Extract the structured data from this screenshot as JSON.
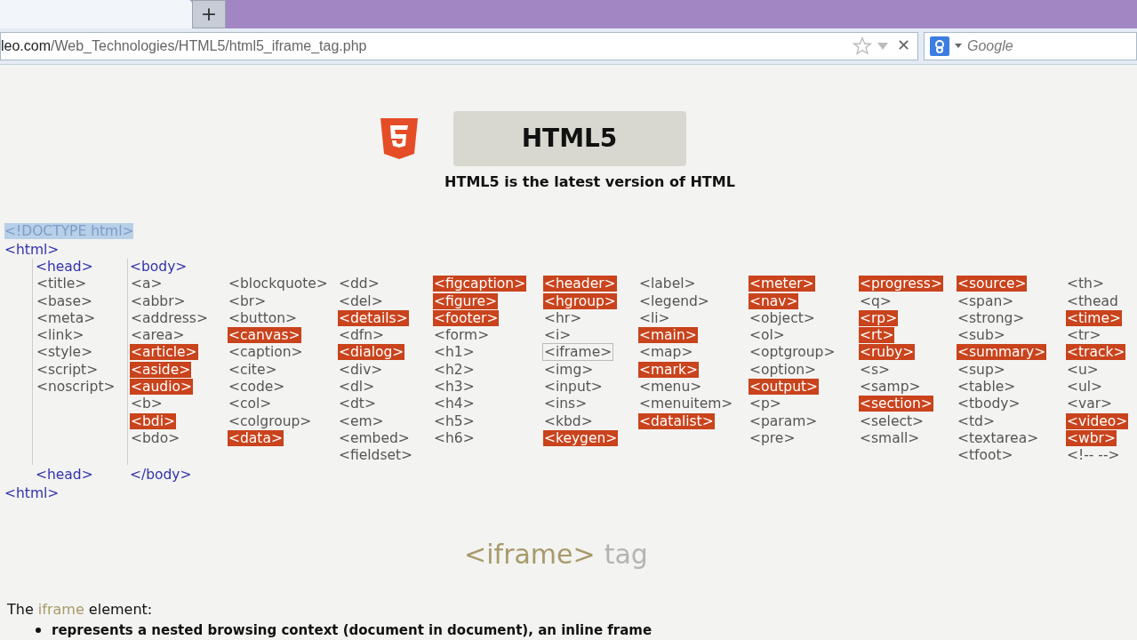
{
  "browser": {
    "new_tab": "+",
    "address": {
      "domain": "leo.com",
      "path": "/Web_Technologies/HTML5/html5_iframe_tag.php"
    },
    "stop": "✕",
    "search": {
      "placeholder": "Google"
    }
  },
  "banner": {
    "title": "HTML5",
    "subtitle": "HTML5 is the latest version of HTML"
  },
  "tree": {
    "doctype": {
      "text": "<!DOCTYPE html>",
      "selected": true
    },
    "html_open": "<html>",
    "head_open": "<head>",
    "body_open": "<body>",
    "head_close": "<head>",
    "body_close": "</body>",
    "html_close": "<html>",
    "head_items": [
      {
        "text": "<title>",
        "kind": "plain"
      },
      {
        "text": "<base>",
        "kind": "plain"
      },
      {
        "text": "<meta>",
        "kind": "plain"
      },
      {
        "text": "<link>",
        "kind": "plain"
      },
      {
        "text": "<style>",
        "kind": "plain"
      },
      {
        "text": "<script>",
        "kind": "plain"
      },
      {
        "text": "<noscript>",
        "kind": "plain"
      }
    ],
    "body_columns": [
      [
        {
          "text": "<a>",
          "kind": "plain"
        },
        {
          "text": "<abbr>",
          "kind": "plain"
        },
        {
          "text": "<address>",
          "kind": "plain"
        },
        {
          "text": "<area>",
          "kind": "plain"
        },
        {
          "text": "<article>",
          "kind": "new"
        },
        {
          "text": "<aside>",
          "kind": "new"
        },
        {
          "text": "<audio>",
          "kind": "new"
        },
        {
          "text": "<b>",
          "kind": "plain"
        },
        {
          "text": "<bdi>",
          "kind": "new"
        },
        {
          "text": "<bdo>",
          "kind": "plain"
        }
      ],
      [
        {
          "text": "<blockquote>",
          "kind": "plain"
        },
        {
          "text": "<br>",
          "kind": "plain"
        },
        {
          "text": "<button>",
          "kind": "plain"
        },
        {
          "text": "<canvas>",
          "kind": "new"
        },
        {
          "text": "<caption>",
          "kind": "plain"
        },
        {
          "text": "<cite>",
          "kind": "plain"
        },
        {
          "text": "<code>",
          "kind": "plain"
        },
        {
          "text": "<col>",
          "kind": "plain"
        },
        {
          "text": "<colgroup>",
          "kind": "plain"
        },
        {
          "text": "<data>",
          "kind": "new"
        }
      ],
      [
        {
          "text": "<dd>",
          "kind": "plain"
        },
        {
          "text": "<del>",
          "kind": "plain"
        },
        {
          "text": "<details>",
          "kind": "new"
        },
        {
          "text": "<dfn>",
          "kind": "plain"
        },
        {
          "text": "<dialog>",
          "kind": "new"
        },
        {
          "text": "<div>",
          "kind": "plain"
        },
        {
          "text": "<dl>",
          "kind": "plain"
        },
        {
          "text": "<dt>",
          "kind": "plain"
        },
        {
          "text": "<em>",
          "kind": "plain"
        },
        {
          "text": "<embed>",
          "kind": "plain"
        },
        {
          "text": "<fieldset>",
          "kind": "plain"
        }
      ],
      [
        {
          "text": "<figcaption>",
          "kind": "new"
        },
        {
          "text": "<figure>",
          "kind": "new"
        },
        {
          "text": "<footer>",
          "kind": "new"
        },
        {
          "text": "<form>",
          "kind": "plain"
        },
        {
          "text": "<h1>",
          "kind": "plain"
        },
        {
          "text": "<h2>",
          "kind": "plain"
        },
        {
          "text": "<h3>",
          "kind": "plain"
        },
        {
          "text": "<h4>",
          "kind": "plain"
        },
        {
          "text": "<h5>",
          "kind": "plain"
        },
        {
          "text": "<h6>",
          "kind": "plain"
        }
      ],
      [
        {
          "text": "<header>",
          "kind": "new"
        },
        {
          "text": "<hgroup>",
          "kind": "new"
        },
        {
          "text": "<hr>",
          "kind": "plain"
        },
        {
          "text": "<i>",
          "kind": "plain"
        },
        {
          "text": "<iframe>",
          "kind": "current"
        },
        {
          "text": "<img>",
          "kind": "plain"
        },
        {
          "text": "<input>",
          "kind": "plain"
        },
        {
          "text": "<ins>",
          "kind": "plain"
        },
        {
          "text": "<kbd>",
          "kind": "plain"
        },
        {
          "text": "<keygen>",
          "kind": "new"
        }
      ],
      [
        {
          "text": "<label>",
          "kind": "plain"
        },
        {
          "text": "<legend>",
          "kind": "plain"
        },
        {
          "text": "<li>",
          "kind": "plain"
        },
        {
          "text": "<main>",
          "kind": "new"
        },
        {
          "text": "<map>",
          "kind": "plain"
        },
        {
          "text": "<mark>",
          "kind": "new"
        },
        {
          "text": "<menu>",
          "kind": "plain"
        },
        {
          "text": "<menuitem>",
          "kind": "plain"
        },
        {
          "text": "<datalist>",
          "kind": "new"
        }
      ],
      [
        {
          "text": "<meter>",
          "kind": "new"
        },
        {
          "text": "<nav>",
          "kind": "new"
        },
        {
          "text": "<object>",
          "kind": "plain"
        },
        {
          "text": "<ol>",
          "kind": "plain"
        },
        {
          "text": "<optgroup>",
          "kind": "plain"
        },
        {
          "text": "<option>",
          "kind": "plain"
        },
        {
          "text": "<output>",
          "kind": "new"
        },
        {
          "text": "<p>",
          "kind": "plain"
        },
        {
          "text": "<param>",
          "kind": "plain"
        },
        {
          "text": "<pre>",
          "kind": "plain"
        }
      ],
      [
        {
          "text": "<progress>",
          "kind": "new"
        },
        {
          "text": "<q>",
          "kind": "plain"
        },
        {
          "text": "<rp>",
          "kind": "new"
        },
        {
          "text": "<rt>",
          "kind": "new"
        },
        {
          "text": "<ruby>",
          "kind": "new"
        },
        {
          "text": "<s>",
          "kind": "plain"
        },
        {
          "text": "<samp>",
          "kind": "plain"
        },
        {
          "text": "<section>",
          "kind": "new"
        },
        {
          "text": "<select>",
          "kind": "plain"
        },
        {
          "text": "<small>",
          "kind": "plain"
        }
      ],
      [
        {
          "text": "<source>",
          "kind": "new"
        },
        {
          "text": "<span>",
          "kind": "plain"
        },
        {
          "text": "<strong>",
          "kind": "plain"
        },
        {
          "text": "<sub>",
          "kind": "plain"
        },
        {
          "text": "<summary>",
          "kind": "new"
        },
        {
          "text": "<sup>",
          "kind": "plain"
        },
        {
          "text": "<table>",
          "kind": "plain"
        },
        {
          "text": "<tbody>",
          "kind": "plain"
        },
        {
          "text": "<td>",
          "kind": "plain"
        },
        {
          "text": "<textarea>",
          "kind": "plain"
        },
        {
          "text": "<tfoot>",
          "kind": "plain"
        }
      ],
      [
        {
          "text": "<th>",
          "kind": "plain"
        },
        {
          "text": "<thead",
          "kind": "plain"
        },
        {
          "text": "<time>",
          "kind": "new"
        },
        {
          "text": "<tr>",
          "kind": "plain"
        },
        {
          "text": "<track>",
          "kind": "new"
        },
        {
          "text": "<u>",
          "kind": "plain"
        },
        {
          "text": "<ul>",
          "kind": "plain"
        },
        {
          "text": "<var>",
          "kind": "plain"
        },
        {
          "text": "<video>",
          "kind": "new"
        },
        {
          "text": "<wbr>",
          "kind": "new"
        },
        {
          "text": "<!-- -->",
          "kind": "plain"
        }
      ]
    ]
  },
  "heading": {
    "tag": "<iframe>",
    "word": "tag"
  },
  "intro": {
    "before": "The",
    "term": "iframe",
    "after": "element:"
  },
  "bullets": [
    "represents a nested browsing context (document in document), an inline frame"
  ]
}
